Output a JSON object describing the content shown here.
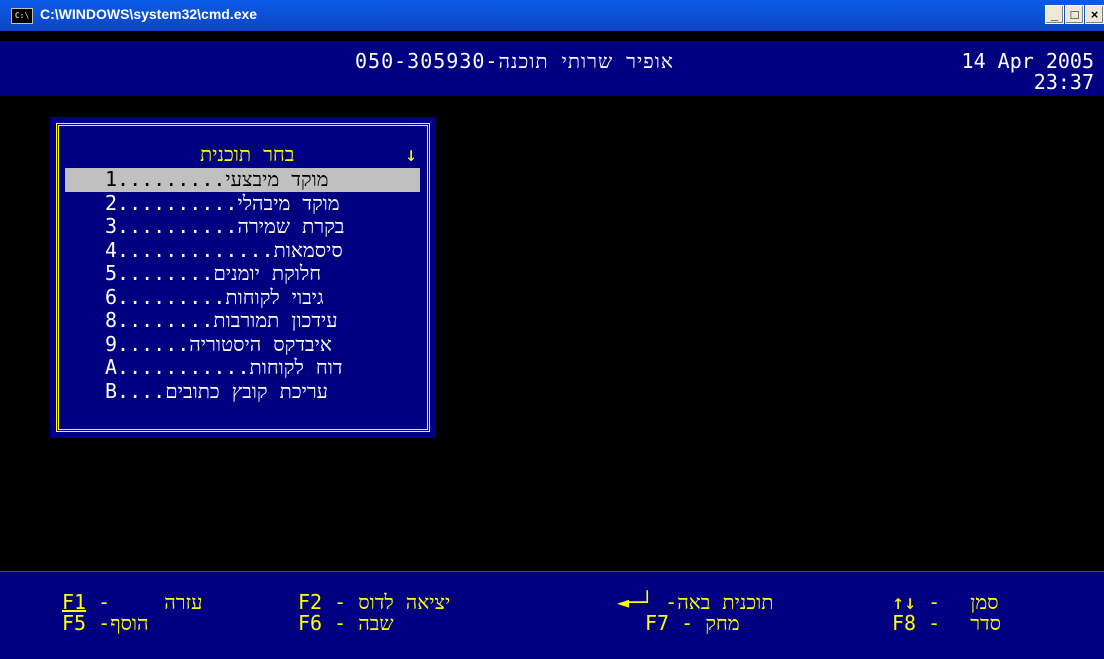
{
  "window": {
    "title": "C:\\WINDOWS\\system32\\cmd.exe",
    "icon_text": "C:\\",
    "minimize_label": "_",
    "maximize_label": "□",
    "close_label": "×"
  },
  "header": {
    "title": "אופיר שרותי תוכנה-050-305930",
    "date": "14 Apr 2005",
    "time": "23:37"
  },
  "menu": {
    "title": "בחר תוכנית",
    "arrow": "↓",
    "items": [
      {
        "num": "1.........",
        "label": "מוקד מיבצעי",
        "selected": true
      },
      {
        "num": "2..........",
        "label": "מוקד מיבהלי",
        "selected": false
      },
      {
        "num": "3..........",
        "label": "בקרת שמירה",
        "selected": false
      },
      {
        "num": "4.............",
        "label": "סיסמאות",
        "selected": false
      },
      {
        "num": "5........",
        "label": "חלוקת יומנים",
        "selected": false
      },
      {
        "num": "6.........",
        "label": "גיבוי לקוחות",
        "selected": false
      },
      {
        "num": "8........",
        "label": "עידכון תמורבות",
        "selected": false
      },
      {
        "num": "9......",
        "label": "איבדקס היסטוריה",
        "selected": false
      },
      {
        "num": "A...........",
        "label": "דוח לקוחות",
        "selected": false
      },
      {
        "num": "B....",
        "label": "עריכת קובץ כתובים",
        "selected": false
      }
    ]
  },
  "fkeys": {
    "f1": {
      "key": "F1",
      "dash": " - ",
      "desc": "עזרה"
    },
    "f2": {
      "key": "F2",
      "dash": " - ",
      "desc": "יציאה לדוס"
    },
    "enter": {
      "key": "◄─┘",
      "dash": " -",
      "desc": "תוכנית באה"
    },
    "arrows": {
      "key": "↑↓",
      "dash": " -  ",
      "desc": "סמן"
    },
    "f5": {
      "key": "F5",
      "dash": " -",
      "desc": "הוסף"
    },
    "f6": {
      "key": "F6",
      "dash": " -  ",
      "desc": "שבה"
    },
    "f7": {
      "key": "F7",
      "dash": " -  ",
      "desc": "מחק"
    },
    "f8": {
      "key": "F8",
      "dash": " -  ",
      "desc": "סדר"
    }
  }
}
